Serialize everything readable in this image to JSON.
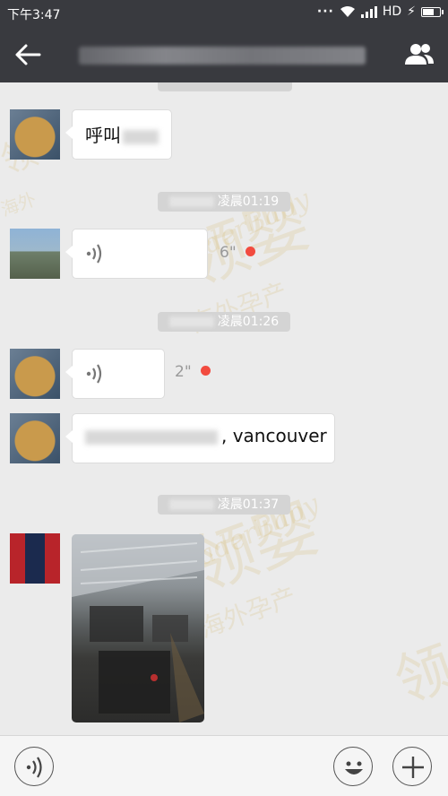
{
  "status_bar": {
    "time": "下午3:47",
    "network": "HD"
  },
  "nav": {
    "title": ""
  },
  "chat": {
    "time_chips": [
      "凌晨01:19",
      "凌晨01:26",
      "凌晨01:37"
    ],
    "messages": [
      {
        "type": "text",
        "text": "呼叫"
      },
      {
        "type": "voice",
        "duration": "6\"",
        "unread": true
      },
      {
        "type": "voice",
        "duration": "2\"",
        "unread": true
      },
      {
        "type": "text",
        "text": ", vancouver"
      },
      {
        "type": "image"
      }
    ]
  },
  "bottom": {},
  "watermark": {
    "brand_cn": "领婴",
    "brand_en": "LeaderBaby",
    "slogan": "海外孕产"
  },
  "colors": {
    "header": "#393a3f",
    "chat_bg": "#ebebeb",
    "unread": "#f24b3f"
  }
}
